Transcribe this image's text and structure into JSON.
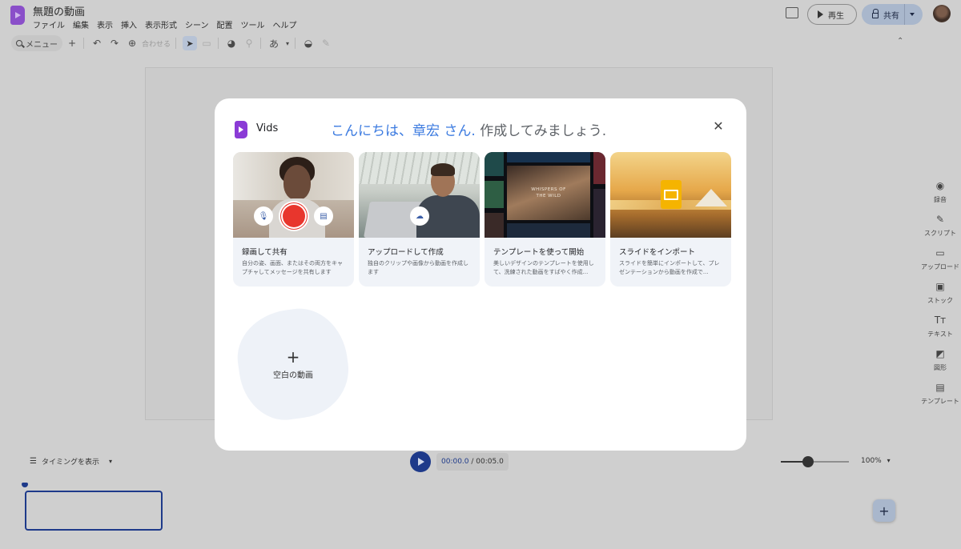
{
  "app": {
    "doc_title": "無題の動画",
    "menu": [
      "ファイル",
      "編集",
      "表示",
      "挿入",
      "表示形式",
      "シーン",
      "配置",
      "ツール",
      "ヘルプ"
    ]
  },
  "header": {
    "play_label": "再生",
    "share_label": "共有"
  },
  "toolbar": {
    "menu_search_label": "メニュー",
    "zoom_fit_label": "合わせる",
    "text_style_label": "あ"
  },
  "right_rail": [
    {
      "label": "録音",
      "icon": "record-icon",
      "glyph": "◉"
    },
    {
      "label": "スクリプト",
      "icon": "script-icon",
      "glyph": "✎"
    },
    {
      "label": "アップロード",
      "icon": "folder-icon",
      "glyph": "▭"
    },
    {
      "label": "ストック",
      "icon": "stock-icon",
      "glyph": "▣"
    },
    {
      "label": "テキスト",
      "icon": "text-icon",
      "glyph": "Tт"
    },
    {
      "label": "図形",
      "icon": "shapes-icon",
      "glyph": "◩"
    },
    {
      "label": "テンプレート",
      "icon": "template-icon",
      "glyph": "▤"
    }
  ],
  "timeline": {
    "timing_label": "タイミングを表示",
    "current_time": "00:00.0",
    "total_time": "/ 00:05.0",
    "zoom_level": "100%",
    "zoom_fraction": 0.4
  },
  "modal": {
    "brand": "Vids",
    "greeting_highlight": "こんにちは、章宏 さん.",
    "greeting_rest": " 作成してみましょう.",
    "cards": [
      {
        "title": "録画して共有",
        "desc": "自分の姿、画面、またはその両方をキャプチャしてメッセージを共有します"
      },
      {
        "title": "アップロードして作成",
        "desc": "独自のクリップや画像から動画を作成します"
      },
      {
        "title": "テンプレートを使って開始",
        "desc": "美しいデザインのテンプレートを使用して、洗練された動画をすばやく作成...",
        "thumb_text_1": "WHISPERS OF",
        "thumb_text_2": "THE WILD"
      },
      {
        "title": "スライドをインポート",
        "desc": "スライドを簡単にインポートして、プレゼンテーションから動画を作成で..."
      }
    ],
    "blank_label": "空白の動画"
  },
  "colors": {
    "accent_blue": "#3c7be0",
    "record_red": "#e8362d",
    "vids_purple": "#8b3bd6",
    "slides_yellow": "#f5b400"
  }
}
